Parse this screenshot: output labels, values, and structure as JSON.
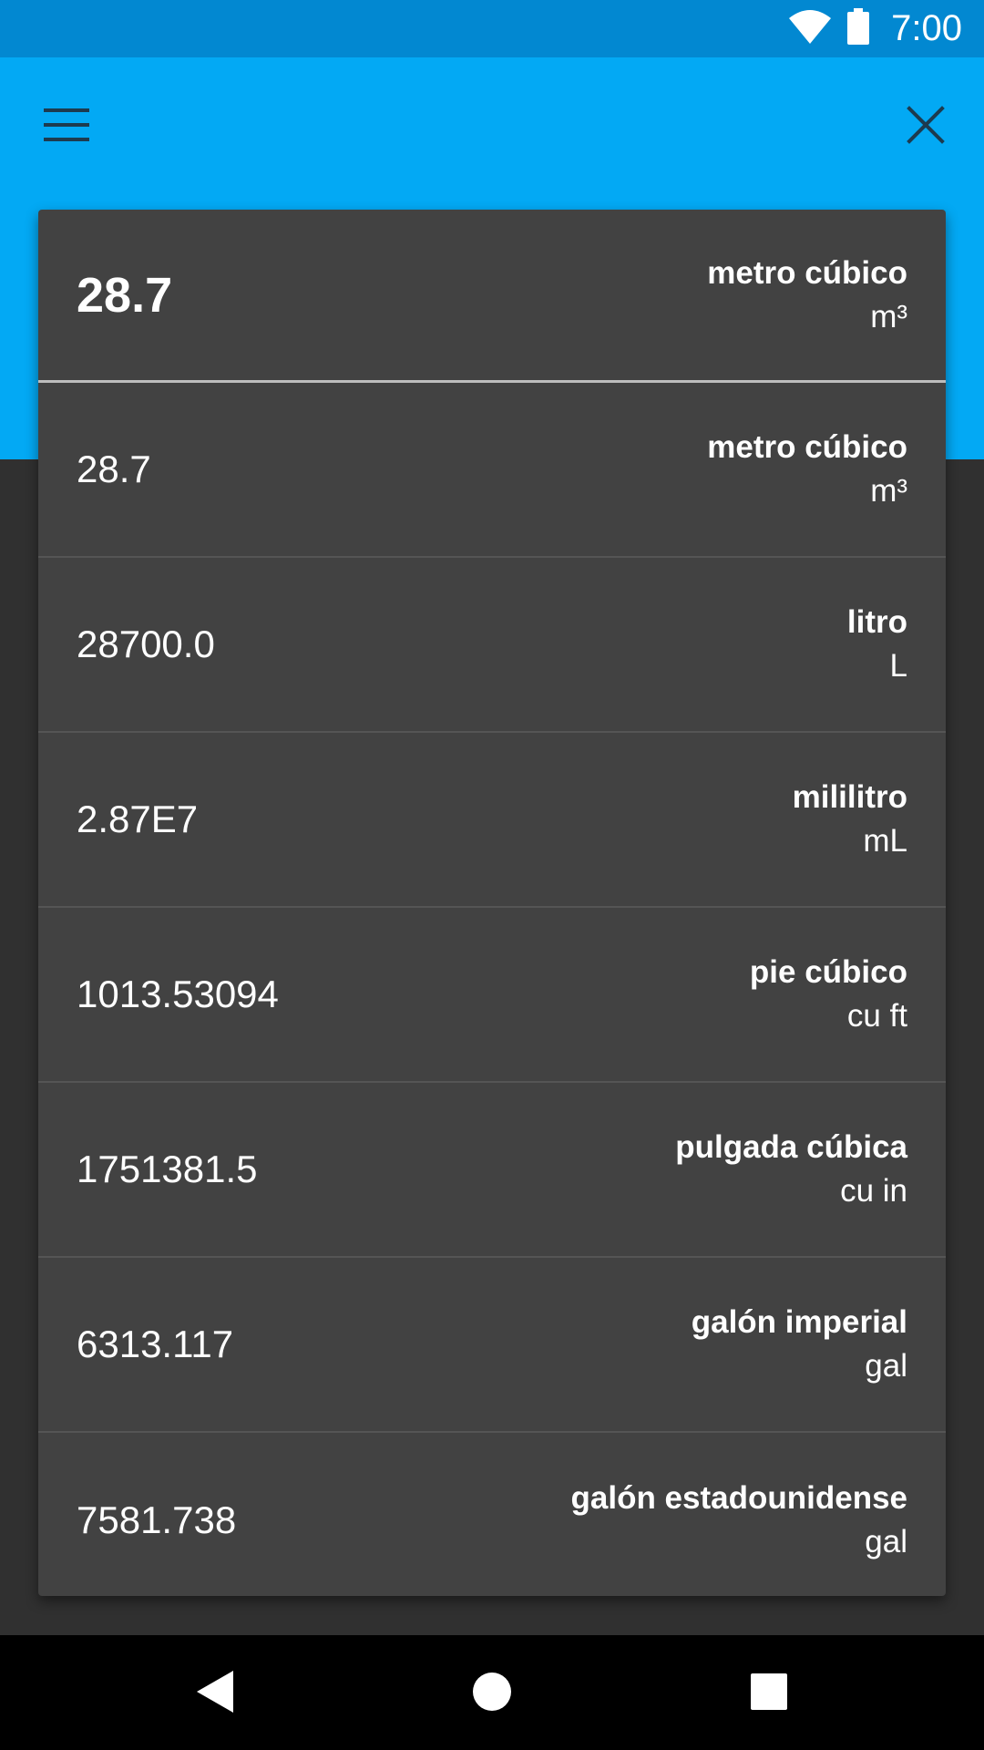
{
  "status": {
    "time": "7:00",
    "wifi_icon": "wifi-icon",
    "battery_icon": "battery-icon"
  },
  "toolbar": {
    "menu_icon": "menu-icon",
    "close_icon": "close-icon"
  },
  "input": {
    "value": "28.7",
    "unit_name": "metro cúbico",
    "unit_symbol": "m³"
  },
  "results": [
    {
      "value": "28.7",
      "unit_name": "metro cúbico",
      "unit_symbol": "m³"
    },
    {
      "value": "28700.0",
      "unit_name": "litro",
      "unit_symbol": "L"
    },
    {
      "value": "2.87E7",
      "unit_name": "mililitro",
      "unit_symbol": "mL"
    },
    {
      "value": "1013.53094",
      "unit_name": "pie cúbico",
      "unit_symbol": "cu ft"
    },
    {
      "value": "1751381.5",
      "unit_name": "pulgada cúbica",
      "unit_symbol": "cu in"
    },
    {
      "value": "6313.117",
      "unit_name": "galón imperial",
      "unit_symbol": "gal"
    },
    {
      "value": "7581.738",
      "unit_name": "galón estadounidense",
      "unit_symbol": "gal"
    }
  ],
  "navigation": {
    "back_icon": "back-icon",
    "home_icon": "home-icon",
    "recents_icon": "recents-icon"
  },
  "colors": {
    "status_bar": "#0288d1",
    "app_bar": "#03a9f4",
    "card": "#424242",
    "background": "#303030"
  }
}
